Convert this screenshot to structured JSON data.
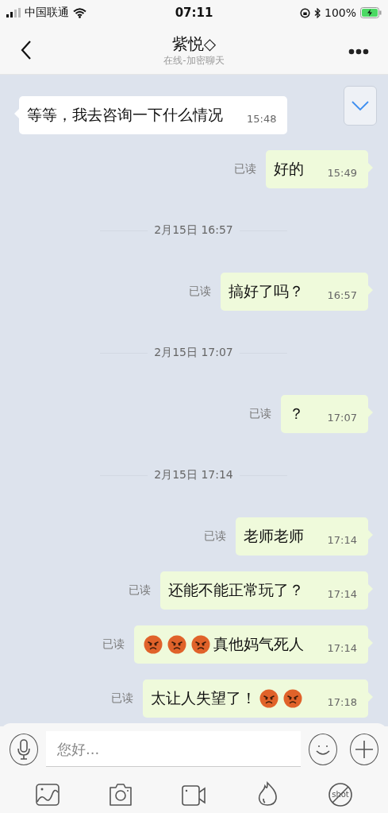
{
  "status_bar": {
    "carrier": "中国联通",
    "time": "07:11",
    "battery": "100%"
  },
  "header": {
    "title": "紫悦◇",
    "subtitle": "在线-加密聊天"
  },
  "messages": [
    {
      "kind": "incoming",
      "parts": [
        {
          "kind": "text",
          "text": "等等，我去咨询一下什么情况"
        }
      ],
      "time": "15:48"
    },
    {
      "kind": "outgoing",
      "read": "已读",
      "parts": [
        {
          "kind": "text",
          "text": "好的"
        }
      ],
      "time": "15:49"
    },
    {
      "kind": "date",
      "text": "2月15日 16:57"
    },
    {
      "kind": "outgoing",
      "read": "已读",
      "parts": [
        {
          "kind": "text",
          "text": "搞好了吗？"
        }
      ],
      "time": "16:57"
    },
    {
      "kind": "date",
      "text": "2月15日 17:07"
    },
    {
      "kind": "outgoing",
      "read": "已读",
      "parts": [
        {
          "kind": "text",
          "text": "？"
        }
      ],
      "time": "17:07"
    },
    {
      "kind": "date",
      "text": "2月15日 17:14"
    },
    {
      "kind": "outgoing",
      "read": "已读",
      "parts": [
        {
          "kind": "text",
          "text": "老师老师"
        }
      ],
      "time": "17:14"
    },
    {
      "kind": "outgoing",
      "read": "已读",
      "parts": [
        {
          "kind": "text",
          "text": "还能不能正常玩了？"
        }
      ],
      "time": "17:14"
    },
    {
      "kind": "outgoing",
      "read": "已读",
      "parts": [
        {
          "kind": "emoji"
        },
        {
          "kind": "emoji"
        },
        {
          "kind": "emoji"
        },
        {
          "kind": "text",
          "text": "真他妈气死人"
        }
      ],
      "time": "17:14"
    },
    {
      "kind": "outgoing",
      "read": "已读",
      "parts": [
        {
          "kind": "text",
          "text": "太让人失望了！"
        },
        {
          "kind": "emoji"
        },
        {
          "kind": "emoji"
        }
      ],
      "time": "17:18"
    }
  ],
  "composer": {
    "placeholder": "您好...",
    "screenshot_label": "shot"
  }
}
